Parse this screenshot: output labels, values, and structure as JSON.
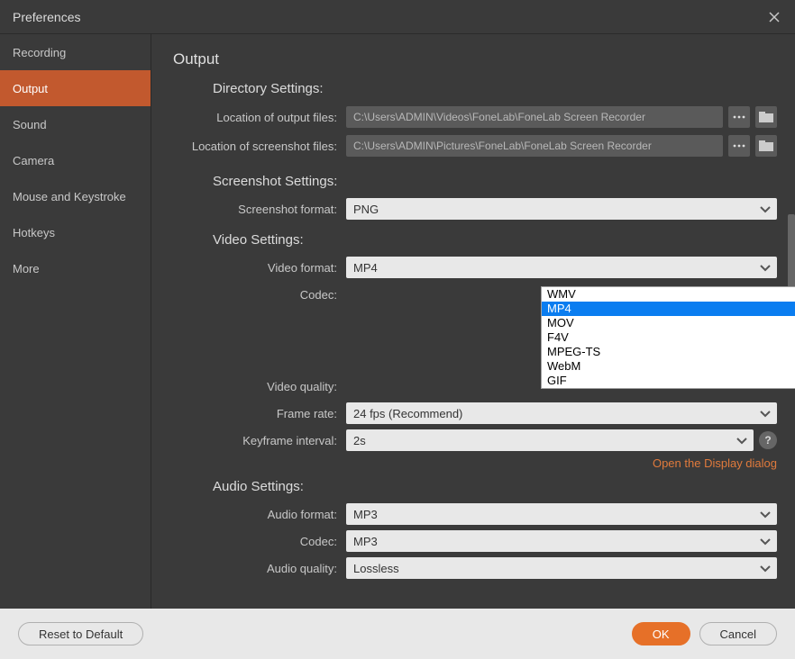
{
  "window": {
    "title": "Preferences"
  },
  "sidebar": {
    "items": [
      {
        "label": "Recording"
      },
      {
        "label": "Output"
      },
      {
        "label": "Sound"
      },
      {
        "label": "Camera"
      },
      {
        "label": "Mouse and Keystroke"
      },
      {
        "label": "Hotkeys"
      },
      {
        "label": "More"
      }
    ],
    "active_index": 1
  },
  "page": {
    "title": "Output"
  },
  "sections": {
    "directory": {
      "title": "Directory Settings:",
      "output_label": "Location of output files:",
      "output_value": "C:\\Users\\ADMIN\\Videos\\FoneLab\\FoneLab Screen Recorder",
      "screenshot_label": "Location of screenshot files:",
      "screenshot_value": "C:\\Users\\ADMIN\\Pictures\\FoneLab\\FoneLab Screen Recorder"
    },
    "screenshot": {
      "title": "Screenshot Settings:",
      "format_label": "Screenshot format:",
      "format_value": "PNG"
    },
    "video": {
      "title": "Video Settings:",
      "format_label": "Video format:",
      "format_value": "MP4",
      "format_options": [
        "WMV",
        "MP4",
        "MOV",
        "F4V",
        "MPEG-TS",
        "WebM",
        "GIF"
      ],
      "format_selected": "MP4",
      "codec_label": "Codec:",
      "quality_label": "Video quality:",
      "framerate_label": "Frame rate:",
      "framerate_value": "24 fps (Recommend)",
      "keyframe_label": "Keyframe interval:",
      "keyframe_value": "2s",
      "display_link": "Open the Display dialog"
    },
    "audio": {
      "title": "Audio Settings:",
      "format_label": "Audio format:",
      "format_value": "MP3",
      "codec_label": "Codec:",
      "codec_value": "MP3",
      "quality_label": "Audio quality:",
      "quality_value": "Lossless"
    }
  },
  "footer": {
    "reset": "Reset to Default",
    "ok": "OK",
    "cancel": "Cancel"
  }
}
